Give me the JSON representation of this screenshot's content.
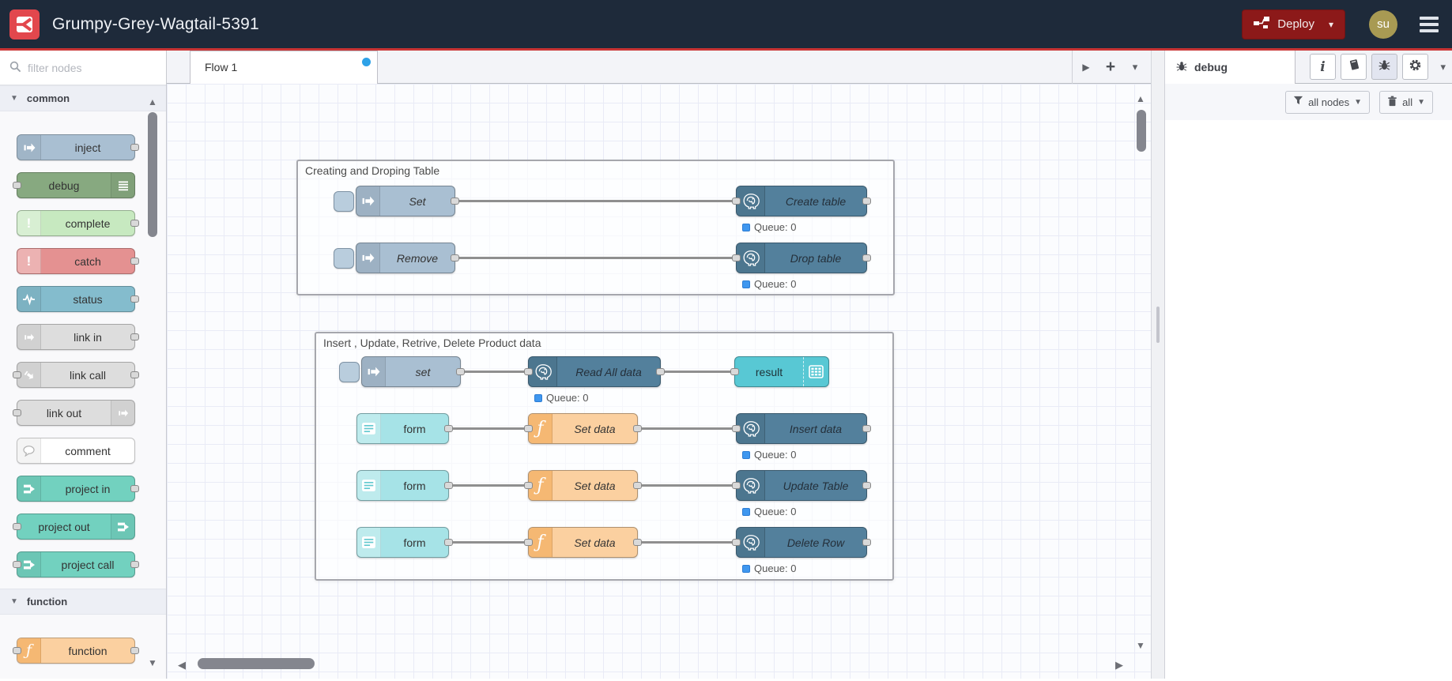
{
  "header": {
    "app_title": "Grumpy-Grey-Wagtail-5391",
    "deploy": {
      "label": "Deploy"
    },
    "user": {
      "initials": "su"
    }
  },
  "palette": {
    "search_placeholder": "filter nodes",
    "categories": [
      {
        "label": "common",
        "nodes": [
          {
            "label": "inject"
          },
          {
            "label": "debug"
          },
          {
            "label": "complete"
          },
          {
            "label": "catch"
          },
          {
            "label": "status"
          },
          {
            "label": "link in"
          },
          {
            "label": "link call"
          },
          {
            "label": "link out"
          },
          {
            "label": "comment"
          },
          {
            "label": "project in"
          },
          {
            "label": "project out"
          },
          {
            "label": "project call"
          }
        ]
      },
      {
        "label": "function",
        "nodes": [
          {
            "label": "function"
          }
        ]
      }
    ]
  },
  "workspace": {
    "active_tab": "Flow 1",
    "groups": [
      {
        "title": "Creating and Droping Table",
        "flows": [
          {
            "source": "Set",
            "target": "Create table",
            "status": "Queue: 0"
          },
          {
            "source": "Remove",
            "target": "Drop table",
            "status": "Queue: 0"
          }
        ]
      },
      {
        "title": "Insert , Update, Retrive, Delete Product data",
        "read_flow": {
          "source": "set",
          "pg": "Read All data",
          "status": "Queue: 0",
          "debug": "result"
        },
        "flows": [
          {
            "source": "form",
            "fn": "Set data",
            "pg": "Insert data",
            "status": "Queue: 0"
          },
          {
            "source": "form",
            "fn": "Set data",
            "pg": "Update Table",
            "status": "Queue: 0"
          },
          {
            "source": "form",
            "fn": "Set data",
            "pg": "Delete Row",
            "status": "Queue: 0"
          }
        ]
      }
    ]
  },
  "sidebar": {
    "tab_label": "debug",
    "filter_button": "all nodes",
    "clear_button": "all"
  },
  "colors": {
    "header_bg": "#1e2a3a",
    "header_underline": "#c93434",
    "logo_red": "#e2474d",
    "deploy_bg": "#8c1919",
    "avatar_bg": "#a89a53",
    "postgres_node": "#53809c",
    "inject_node": "#a9bfd2",
    "function_node": "#fbd0a0",
    "form_node": "#a6e3e7",
    "result_node": "#58c8d4",
    "project_node": "#72d1bf",
    "debug_node": "#87a980",
    "status_blue": "#3f97ef",
    "flow_modified_dot": "#2ea2e8"
  }
}
